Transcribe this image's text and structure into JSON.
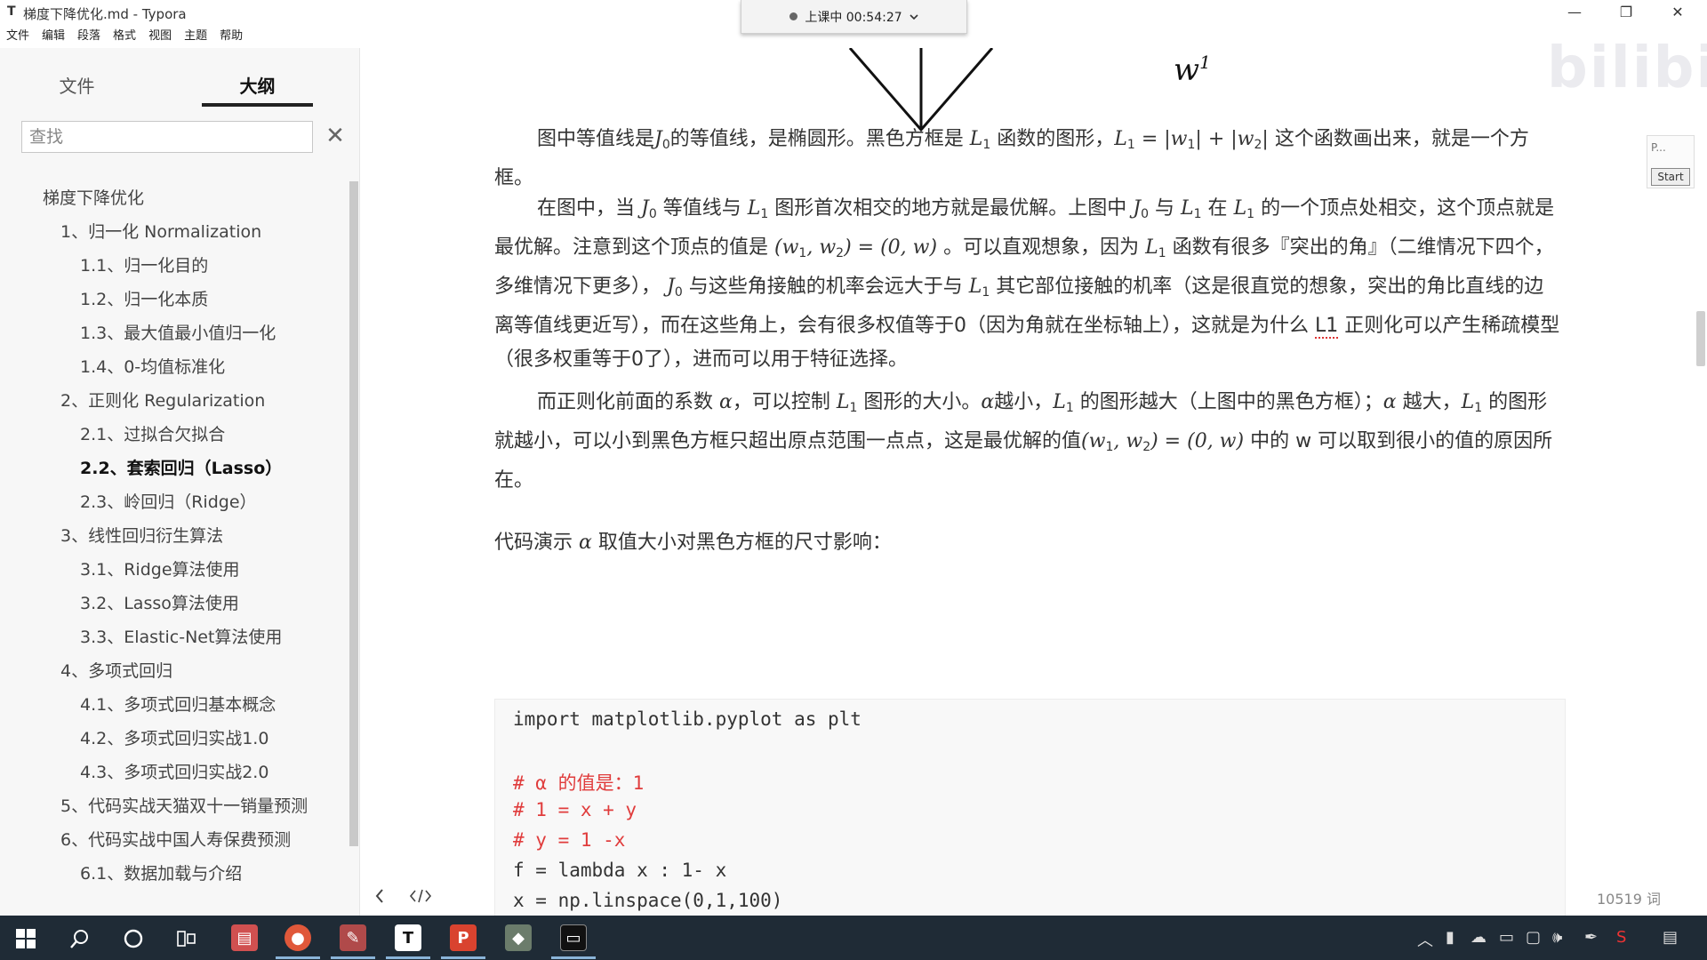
{
  "window": {
    "icon": "T",
    "title": "梯度下降优化.md - Typora",
    "controls": {
      "minimize": "—",
      "maximize": "❐",
      "close": "✕"
    }
  },
  "menu": [
    "文件",
    "编辑",
    "段落",
    "格式",
    "视图",
    "主题",
    "帮助"
  ],
  "timer": {
    "label": "上课中 00:54:27",
    "chevron": "chevron-down-icon"
  },
  "sidebar": {
    "tabs": [
      "文件",
      "大纲"
    ],
    "active_tab": "大纲",
    "search_placeholder": "查找",
    "close": "✕",
    "outline": [
      {
        "label": "梯度下降优化",
        "level": 1
      },
      {
        "label": "1、归一化 Normalization",
        "level": 2
      },
      {
        "label": "1.1、归一化目的",
        "level": 3
      },
      {
        "label": "1.2、归一化本质",
        "level": 3
      },
      {
        "label": "1.3、最大值最小值归一化",
        "level": 3
      },
      {
        "label": "1.4、0-均值标准化",
        "level": 3
      },
      {
        "label": "2、正则化 Regularization",
        "level": 2
      },
      {
        "label": "2.1、过拟合欠拟合",
        "level": 3
      },
      {
        "label": "2.2、套索回归（Lasso）",
        "level": 3,
        "active": true
      },
      {
        "label": "2.3、岭回归（Ridge）",
        "level": 3
      },
      {
        "label": "3、线性回归衍生算法",
        "level": 2
      },
      {
        "label": "3.1、Ridge算法使用",
        "level": 3
      },
      {
        "label": "3.2、Lasso算法使用",
        "level": 3
      },
      {
        "label": "3.3、Elastic-Net算法使用",
        "level": 3
      },
      {
        "label": "4、多项式回归",
        "level": 2
      },
      {
        "label": "4.1、多项式回归基本概念",
        "level": 3
      },
      {
        "label": "4.2、多项式回归实战1.0",
        "level": 3
      },
      {
        "label": "4.3、多项式回归实战2.0",
        "level": 3
      },
      {
        "label": "5、代码实战天猫双十一销量预测",
        "level": 2,
        "wrap": true
      },
      {
        "label": "6、代码实战中国人寿保费预测",
        "level": 2
      },
      {
        "label": "6.1、数据加载与介绍",
        "level": 3
      }
    ]
  },
  "content": {
    "fig_label": "w",
    "fig_sup": "1",
    "p1": {
      "t1": "图中等值线是",
      "m1": "J",
      "s1": "0",
      "t2": "的等值线，是椭圆形。黑色方框是 ",
      "m2": "L",
      "s2": "1",
      "t3": " 函数的图形，",
      "m3": "L",
      "s3": "1",
      "m3b": " = |w",
      "s3b": "1",
      "m3c": "| + |w",
      "s3c": "2",
      "m3d": "|",
      "t4": " 这个函数画出来，就是一个方框。"
    },
    "p2": {
      "t1": "在图中，当 ",
      "m1": "J",
      "s1": "0",
      "t2": " 等值线与 ",
      "m2": "L",
      "s2": "1",
      "t3": " 图形首次相交的地方就是最优解。上图中 ",
      "m3": "J",
      "s3": "0",
      "t4": " 与 ",
      "m4": "L",
      "s4": "1",
      "t5": " 在 ",
      "m5": "L",
      "s5": "1",
      "t6": " 的一个顶点处相交，这个顶点就是最优解。注意到这个顶点的值是 ",
      "m6": "(w",
      "s6": "1",
      "m6b": ", w",
      "s6b": "2",
      "m6c": ") = (0, w)",
      "t7": " 。可以直观想象，因为 ",
      "m7": "L",
      "s7": "1",
      "t8": " 函数有很多『突出的角』（二维情况下四个，多维情况下更多）， ",
      "m8": "J",
      "s8": "0",
      "t9": " 与这些角接触的机率会远大于与 ",
      "m9": "L",
      "s9": "1",
      "t10": " 其它部位接触的机率（这是很直觉的想象，突出的角比直线的边离等值线更近写），而在这些角上，会有很多权值等于0（因为角就在坐标轴上），这就是为什么 ",
      "t11": "L1",
      "t12": " 正则化可以产生稀疏模型（很多权重等于0了），进而可以用于特征选择。"
    },
    "p3": {
      "t1": "而正则化前面的系数 ",
      "m1": "α",
      "t2": "，可以控制 ",
      "m2": "L",
      "s2": "1",
      "t3": " 图形的大小。",
      "m3": "α",
      "t4": "越小，",
      "m4": "L",
      "s4": "1",
      "t5": " 的图形越大（上图中的黑色方框）；",
      "m5": "α",
      "t6": " 越大，",
      "m6": "L",
      "s6": "1",
      "t7": " 的图形就越小，可以小到黑色方框只超出原点范围一点点，这是最优解的值",
      "m7": "(w",
      "s7": "1",
      "m7b": ", w",
      "s7b": "2",
      "m7c": ") = (0, w)",
      "t8": " 中的 w 可以取到很小的值的原因所在。"
    },
    "code_label": {
      "t1": "代码演示 ",
      "m1": "α",
      "t2": " 取值大小对黑色方框的尺寸影响："
    },
    "code_lines": [
      {
        "text": "import matplotlib.pyplot as plt",
        "comment": false
      },
      {
        "text": "",
        "comment": false
      },
      {
        "text": "# α 的值是：1",
        "comment": true
      },
      {
        "text": "# 1 = x + y",
        "comment": true
      },
      {
        "text": "# y = 1 -x",
        "comment": true
      },
      {
        "text": "f = lambda x : 1- x",
        "comment": false
      },
      {
        "text": "x = np.linspace(0,1,100)",
        "comment": false
      }
    ],
    "word_count": "10519 词"
  },
  "side_widget": {
    "p": "P...",
    "start": "Start"
  },
  "watermark": "bilibili",
  "colors": {
    "taskbar": "#1f2b36",
    "comment": "#e03c3c",
    "active_tab_underline": "#222222"
  }
}
